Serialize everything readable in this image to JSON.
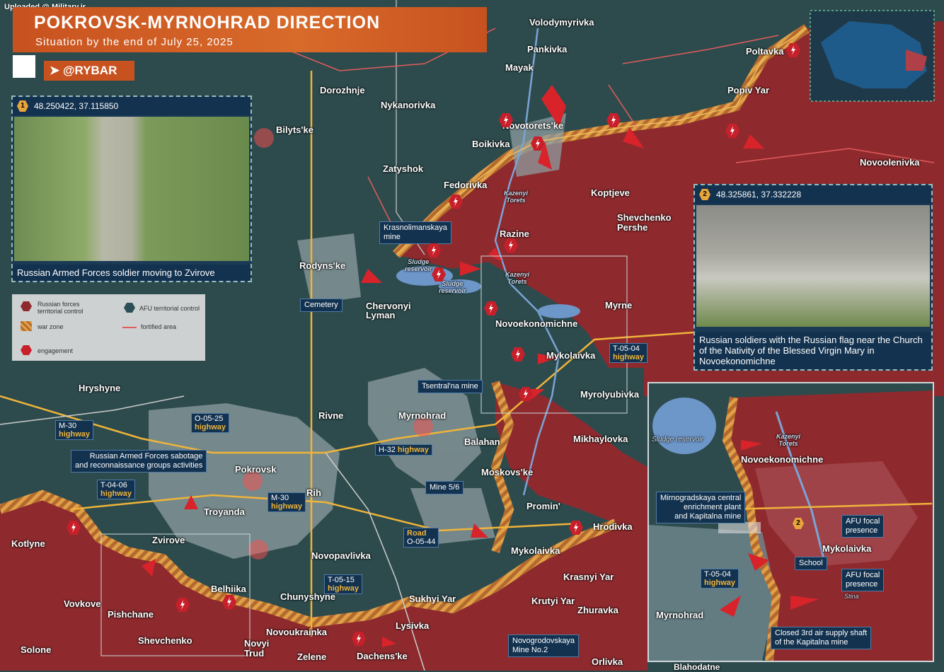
{
  "watermark": "Uploaded @ Military.ir",
  "header": {
    "title": "POKROVSK-MYRNOHRAD DIRECTION",
    "subtitle": "Situation by the end of July 25, 2025",
    "brand": "@RYBAR"
  },
  "photo1": {
    "number": "1",
    "coords": "48.250422, 37.115850",
    "caption": "Russian Armed Forces soldier moving to Zvirove"
  },
  "photo2": {
    "number": "2",
    "coords": "48.325861, 37.332228",
    "caption": "Russian soldiers with the Russian flag near the Church of the Nativity of the Blessed Virgin Mary in Novoekonomichne"
  },
  "legend": {
    "russian": "Russian forces territorial control",
    "afu": "AFU territorial control",
    "war_zone": "war zone",
    "fortified": "fortified area",
    "engagement": "engagement",
    "colors": {
      "russian": "#8e2a2e",
      "afu": "#2c4f55",
      "war_zone": "#d98a2b",
      "engagement": "#c8202a"
    }
  },
  "places": {
    "volodymyrivka": "Volodymyrivka",
    "pankivka": "Pankivka",
    "mayak": "Mayak",
    "dorozhnje": "Dorozhnje",
    "nykanorivka": "Nykanorivka",
    "bilytske": "Bilyts'ke",
    "novotoretske": "Novotorets'ke",
    "boikivka": "Boikivka",
    "zatyshok": "Zatyshok",
    "fedorivka": "Fedorivka",
    "koptjeve": "Koptjeve",
    "shevchenko_pershe": "Shevchenko\nPershe",
    "poltavka": "Poltavka",
    "popiv_yar": "Popiv Yar",
    "novoolenivka": "Novoolenivka",
    "razine": "Razine",
    "rodynske": "Rodyns'ke",
    "chervonyi_lyman": "Chervonyi\nLyman",
    "myrne": "Myrne",
    "novoekonomichne": "Novoekonomichne",
    "mykolaivka": "Mykolaivka",
    "myrolyubivka": "Myrolyubivka",
    "hryshyne": "Hryshyne",
    "rivne": "Rivne",
    "myrnohrad": "Myrnohrad",
    "balahan": "Balahan",
    "mikhaylovka": "Mikhaylovka",
    "moskovske": "Moskovs'ke",
    "pokrovsk": "Pokrovsk",
    "rih": "Rih",
    "troyanda": "Troyanda",
    "promin": "Promin'",
    "hrodivka": "Hrodivka",
    "kotlyne": "Kotlyne",
    "zvirove": "Zvirove",
    "novopavlivka": "Novopavlivka",
    "mykolaivka2": "Mykolaivka",
    "krasnyi_yar": "Krasnyi Yar",
    "belhiika": "Belhiika",
    "vovkove": "Vovkove",
    "pishchane": "Pishchane",
    "chunyshyne": "Chunyshyne",
    "sukhyi_yar": "Sukhyi Yar",
    "krutyi_yar": "Krutyi Yar",
    "zhuravka": "Zhuravka",
    "shevchenko": "Shevchenko",
    "novoukrainka": "Novoukrainka",
    "lysivka": "Lysivka",
    "solone": "Solone",
    "novyi_trud": "Novyi\nTrud",
    "zelene": "Zelene",
    "dachenske": "Dachens'ke",
    "orlivka": "Orlivka",
    "blahodatne": "Blahodatne"
  },
  "water": {
    "kazenyi_torets1": "Kazenyi\nTorets",
    "kazenyi_torets2": "Kazenyi\nTorets",
    "sludge1": "Sludge\nreservoir",
    "sludge2": "Sludge\nreservoir"
  },
  "callouts": {
    "krasnolimanskaya": "Krasnolimanskaya\nmine",
    "cemetery": "Cemetery",
    "tsentralna": "Tsentral'na mine",
    "mine56": "Mine 5/6",
    "sabotage": "Russian Armed Forces sabotage\nand reconnaissance groups activities",
    "novogrodovskaya": "Novogrodovskaya\nMine No.2"
  },
  "highways": {
    "t0504": {
      "code": "T-05-04",
      "kind": "highway"
    },
    "o0525": {
      "code": "O-05-25",
      "kind": "highway"
    },
    "m30a": {
      "code": "M-30",
      "kind": "highway"
    },
    "h32": {
      "code": "H-32",
      "kind": "highway"
    },
    "t0406": {
      "code": "T-04-06",
      "kind": "highway"
    },
    "m30b": {
      "code": "M-30",
      "kind": "highway"
    },
    "road": {
      "code": "Road",
      "kind": "O-05-44"
    },
    "t0515": {
      "code": "T-05-15",
      "kind": "highway"
    }
  },
  "inset": {
    "sludge": "Sludge reservoir",
    "kazenyi": "Kazenyi\nTorets",
    "novoekonomichne": "Novoekonomichne",
    "mirnogradskaya": "Mirnogradskaya central\nenrichment plant\nand Kapitalna mine",
    "afu_focal1": "AFU focal\npresence",
    "afu_focal2": "AFU focal\npresence",
    "mykolaivka": "Mykolaivka",
    "school": "School",
    "t0504": "T-05-04",
    "t0504_kind": "highway",
    "myrnohrad": "Myrnohrad",
    "closed_shaft": "Closed 3rd air supply shaft\nof the Kapitalna mine",
    "stina": "Stina",
    "num": "2"
  }
}
